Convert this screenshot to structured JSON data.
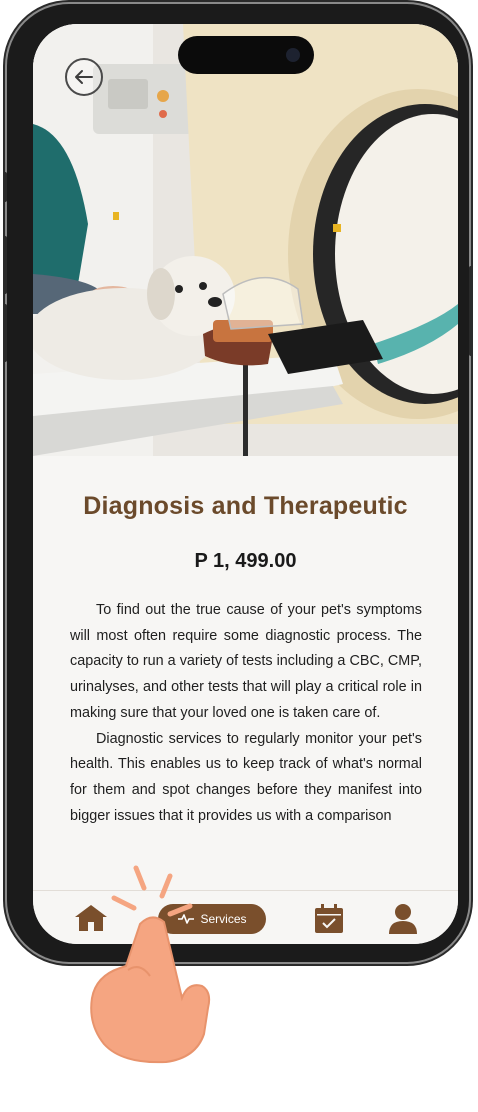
{
  "header": {
    "back_icon": "arrow-left-icon"
  },
  "service": {
    "title": "Diagnosis and Therapeutic",
    "price": "P 1, 499.00",
    "paragraphs": [
      "To find out the true cause of your pet's symptoms will most often require some diagnostic process. The capacity to run a variety of tests including a CBC, CMP, urinalyses, and other tests that will play a critical role in making sure that your loved one is taken care of.",
      "Diagnostic services to regularly monitor your pet's health. This enables us to keep track of what's normal for them and spot changes before they manifest into bigger issues that it provides us with a comparison"
    ]
  },
  "nav": {
    "items": [
      {
        "icon": "home-icon"
      },
      {
        "icon": "services-icon",
        "label": "Services",
        "active": true
      },
      {
        "icon": "calendar-check-icon"
      },
      {
        "icon": "user-icon"
      }
    ]
  },
  "colors": {
    "brand_brown": "#6b4a2b",
    "pill_brown": "#7a4f2c",
    "hand_skin": "#f5a581"
  }
}
